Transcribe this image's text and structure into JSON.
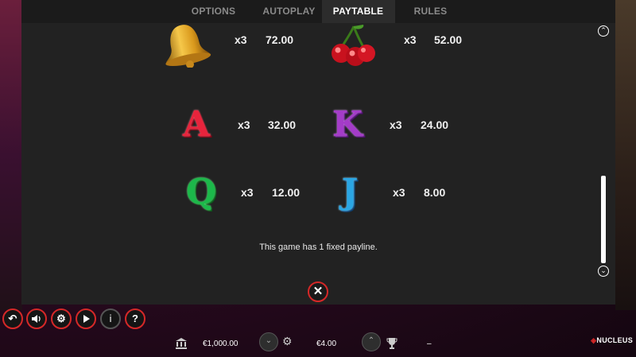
{
  "tabs": [
    {
      "label": "OPTIONS"
    },
    {
      "label": "AUTOPLAY"
    },
    {
      "label": "PAYTABLE"
    },
    {
      "label": "RULES"
    }
  ],
  "paytable": {
    "symbols": [
      {
        "icon": "bell-icon",
        "multiplier": "x3",
        "payout": "72.00"
      },
      {
        "icon": "cherries-icon",
        "multiplier": "x3",
        "payout": "52.00"
      },
      {
        "icon": "letter-a-icon",
        "glyph": "A",
        "color": "#e8243c",
        "multiplier": "x3",
        "payout": "32.00"
      },
      {
        "icon": "letter-k-icon",
        "glyph": "K",
        "color": "#a43cc8",
        "multiplier": "x3",
        "payout": "24.00"
      },
      {
        "icon": "letter-q-icon",
        "glyph": "Q",
        "color": "#1cb84a",
        "multiplier": "x3",
        "payout": "12.00"
      },
      {
        "icon": "letter-j-icon",
        "glyph": "J",
        "color": "#2aa6e4",
        "multiplier": "x3",
        "payout": "8.00"
      }
    ],
    "note": "This game has 1 fixed payline."
  },
  "colors": {
    "accent": "#d62828",
    "panel": "#222222",
    "tab_active_bg": "#2c2c2c"
  },
  "toolbar": {
    "buttons": [
      {
        "icon": "back-arrow-icon"
      },
      {
        "icon": "speaker-icon"
      },
      {
        "icon": "gear-icon"
      },
      {
        "icon": "play-icon"
      },
      {
        "icon": "info-icon"
      },
      {
        "icon": "question-icon"
      }
    ],
    "balance": "€1,000.00",
    "bet": "€4.00",
    "win": "–",
    "brand": "NUCLEUS"
  }
}
